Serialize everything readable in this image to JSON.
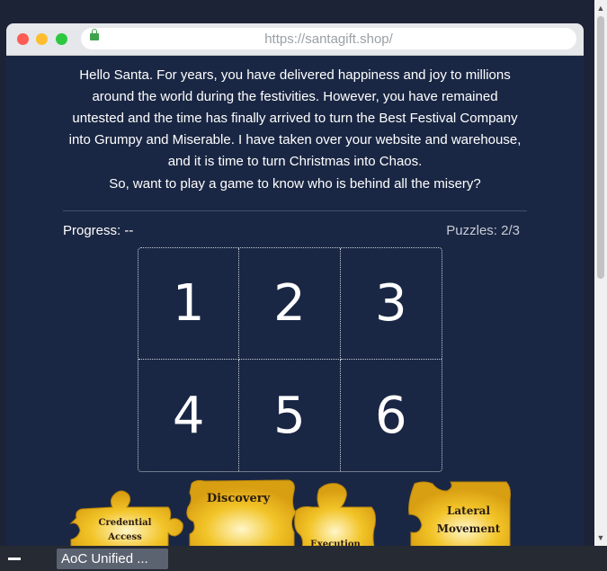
{
  "browser": {
    "url": "https://santagift.shop/",
    "traffic_lights": [
      "close",
      "minimize",
      "maximize"
    ]
  },
  "page": {
    "intro": "Hello Santa. For years, you have delivered happiness and joy to millions around the world during the festivities. However, you have remained untested and the time has finally arrived to turn the Best Festival Company into Grumpy and Miserable. I have taken over your website and warehouse, and it is time to turn Christmas into Chaos.",
    "question": "So, want to play a game to know who is behind all the misery?",
    "progress_label": "Progress: --",
    "puzzles_label": "Puzzles: 2/3",
    "grid": [
      {
        "label": "1"
      },
      {
        "label": "2"
      },
      {
        "label": "3"
      },
      {
        "label": "4"
      },
      {
        "label": "5"
      },
      {
        "label": "6"
      }
    ],
    "pieces": [
      {
        "line1": "Credential",
        "line2": "Access"
      },
      {
        "line1": "Discovery",
        "line2": ""
      },
      {
        "line1": "Execution",
        "line2": ""
      },
      {
        "line1": "Lateral",
        "line2": "Movement"
      }
    ]
  },
  "taskbar": {
    "app_label": "AoC Unified ..."
  },
  "colors": {
    "page_bg": "#1a2744",
    "puzzle_gold": "#e9b520",
    "taskbar_bg": "#262a33"
  }
}
